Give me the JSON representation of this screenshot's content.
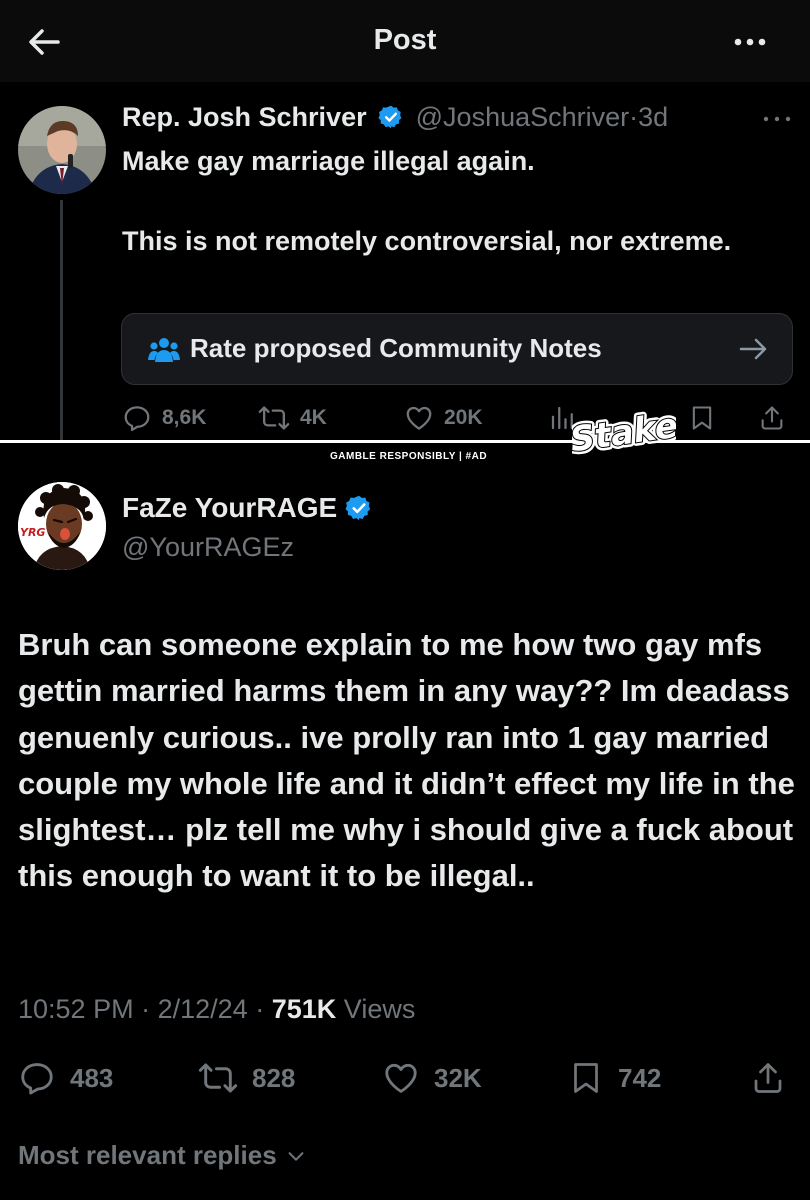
{
  "header": {
    "title": "Post",
    "back_icon": "arrow-left-icon",
    "more_icon": "more-horizontal-icon"
  },
  "quoted_post": {
    "author_name": "Rep. Josh Schriver",
    "handle": "@JoshuaSchriver",
    "time": "3d",
    "separator": "·",
    "verified": true,
    "text_line1": "Make gay marriage illegal again.",
    "text_line2": "This is not remotely controversial, nor extreme.",
    "community_note_label": "Rate proposed Community Notes",
    "actions": {
      "replies": "8,6K",
      "reposts": "4K",
      "likes": "20K"
    }
  },
  "ad": {
    "brand": "Stake",
    "disclaimer": "GAMBLE RESPONSIBLY  |  #AD"
  },
  "main_post": {
    "author_name": "FaZe YourRAGE",
    "handle": "@YourRAGEz",
    "verified": true,
    "body": "Bruh can someone explain to me how two gay mfs gettin married harms them in any way?? Im deadass genuenly curious.. ive prolly ran into 1 gay married couple my whole life and it didn’t effect my life in the slightest… plz tell me why i should give a fuck about this enough to want it to be illegal..",
    "time": "10:52 PM",
    "date": "2/12/24",
    "separator": "·",
    "views_count": "751K",
    "views_label": "Views",
    "actions": {
      "replies": "483",
      "reposts": "828",
      "likes": "32K",
      "bookmarks": "742"
    }
  },
  "replies_sort_label": "Most relevant replies",
  "colors": {
    "background": "#000000",
    "text": "#e7e9ea",
    "secondary": "#71767b",
    "verified": "#1d9bf0"
  }
}
